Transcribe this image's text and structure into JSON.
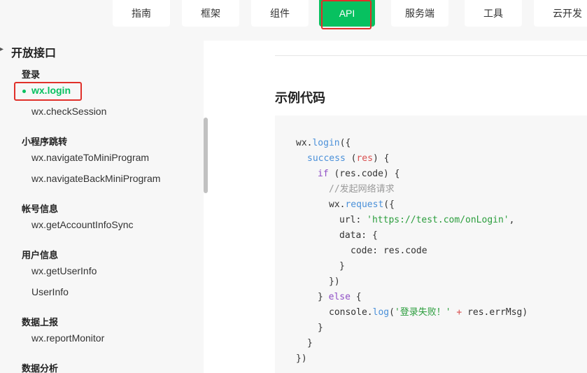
{
  "nav": {
    "tabs": [
      {
        "label": "指南"
      },
      {
        "label": "框架"
      },
      {
        "label": "组件"
      },
      {
        "label": "API"
      },
      {
        "label": "服务端"
      },
      {
        "label": "工具"
      },
      {
        "label": "云开发"
      }
    ],
    "active_index": 3,
    "accent_color": "#07c160",
    "highlight_color": "#e0302a"
  },
  "sidebar": {
    "section_title": "开放接口",
    "groups": [
      {
        "title": "登录",
        "items": [
          {
            "label": "wx.login"
          },
          {
            "label": "wx.checkSession"
          }
        ]
      },
      {
        "title": "小程序跳转",
        "items": [
          {
            "label": "wx.navigateToMiniProgram"
          },
          {
            "label": "wx.navigateBackMiniProgram"
          }
        ]
      },
      {
        "title": "帐号信息",
        "items": [
          {
            "label": "wx.getAccountInfoSync"
          }
        ]
      },
      {
        "title": "用户信息",
        "items": [
          {
            "label": "wx.getUserInfo"
          },
          {
            "label": "UserInfo"
          }
        ]
      },
      {
        "title": "数据上报",
        "items": [
          {
            "label": "wx.reportMonitor"
          }
        ]
      },
      {
        "title": "数据分析",
        "items": []
      }
    ]
  },
  "main": {
    "heading": "示例代码",
    "code": {
      "l1_obj": "wx.",
      "l1_fn": "login",
      "l1_rest": "({",
      "l2_key": "success",
      "l2_a": " (",
      "l2_param": "res",
      "l2_b": ") {",
      "l3_kw": "if",
      "l3_rest": " (res.code) {",
      "l4_comment": "//发起网络请求",
      "l5_obj": "wx.",
      "l5_fn": "request",
      "l5_rest": "({",
      "l6_key": "url: ",
      "l6_str": "'https://test.com/onLogin'",
      "l6_end": ",",
      "l7": "data: {",
      "l8": "code: res.code",
      "l9": "}",
      "l10": "})",
      "l11_a": "} ",
      "l11_kw": "else",
      "l11_b": " {",
      "l12_obj": "console.",
      "l12_fn": "log",
      "l12_a": "(",
      "l12_str": "'登录失败！'",
      "l12_op": " + ",
      "l12_b": "res.errMsg)",
      "l13": "}",
      "l14": "}",
      "l15": "})"
    }
  }
}
